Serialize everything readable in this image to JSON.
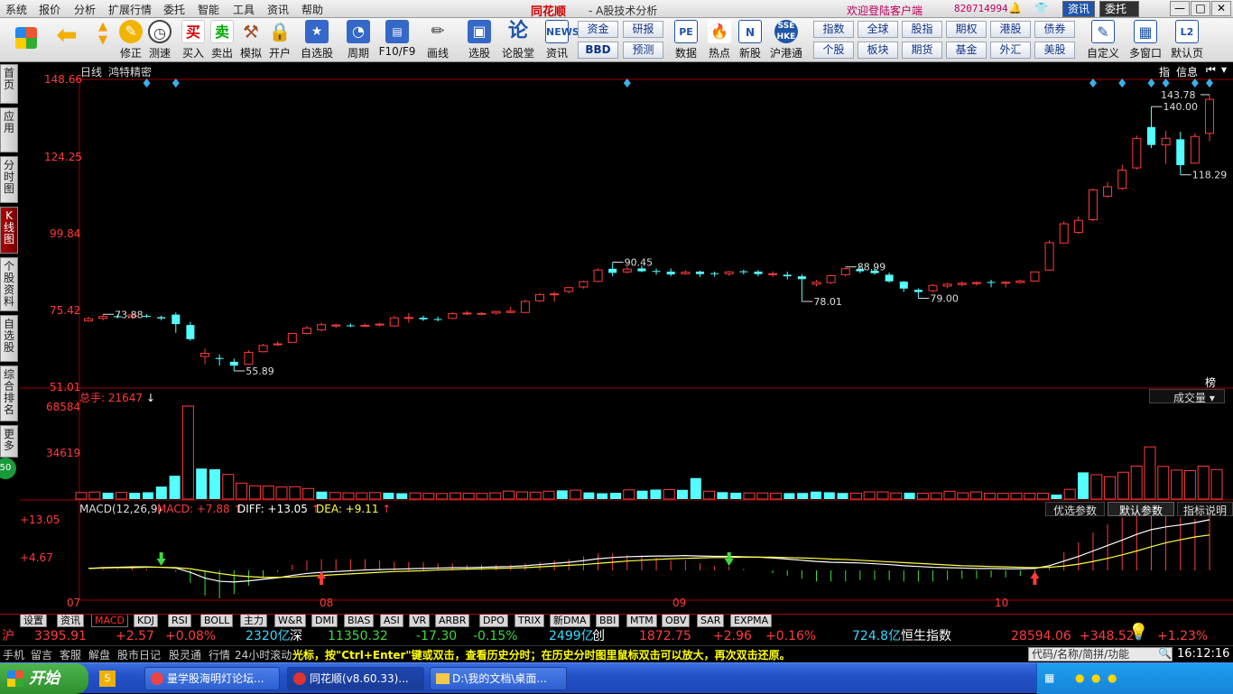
{
  "menubar": {
    "items": [
      "系统",
      "报价",
      "分析",
      "扩展行情",
      "委托",
      "智能",
      "工具",
      "资讯",
      "帮助"
    ],
    "app_name": "同花顺",
    "app_subtitle": "- A股技术分析",
    "welcome": "欢迎登陆客户端",
    "account": "820714994",
    "news_btn": "资讯",
    "trade_btn": "委托",
    "win_min": "—",
    "win_max": "□",
    "win_close": "✕"
  },
  "toolbar": {
    "buttons": [
      "",
      "",
      "修正",
      "测速",
      "买入",
      "卖出",
      "模拟",
      "开户",
      "自选股",
      "周期",
      "F10/F9",
      "画线",
      "选股",
      "论股堂",
      "资讯",
      "数据",
      "热点",
      "新股",
      "沪港通",
      "自定义",
      "多窗口",
      "默认页"
    ],
    "small_left": [
      "资金",
      "BBD",
      "研报",
      "预测"
    ],
    "small_right": [
      "指数",
      "全球",
      "股指",
      "期权",
      "港股",
      "债券",
      "个股",
      "板块",
      "期货",
      "基金",
      "外汇",
      "美股"
    ]
  },
  "leftnav": [
    "首页",
    "应用",
    "分时图",
    "K线图",
    "个股资料",
    "自选股",
    "综合排名",
    "更多"
  ],
  "chart_header": {
    "period": "日线",
    "stock_name": "鸿特精密",
    "corner_btn": "指",
    "info_btn": "信息",
    "bang": "榜"
  },
  "price_axis": [
    "148.66",
    "124.25",
    "99.84",
    "75.42",
    "51.01"
  ],
  "annotations": [
    "73.88",
    "55.89",
    "90.45",
    "78.01",
    "88.99",
    "79.00",
    "118.29",
    "140.00",
    "143.78"
  ],
  "volume_panel": {
    "label": "总手: 21647",
    "axis": [
      "68584",
      "34619"
    ],
    "type_select": "成交量"
  },
  "macd_panel": {
    "title": "MACD(12,26,9)",
    "macd": "MACD: +7.88",
    "diff": "DIFF: +13.05",
    "dea": "DEA: +9.11",
    "axis": [
      "+13.05",
      "+4.67"
    ],
    "btn_opt": "优选参数",
    "btn_default": "默认参数",
    "btn_desc": "指标说明"
  },
  "month_labels": [
    "07",
    "08",
    "09",
    "10"
  ],
  "bottom_tabs": [
    "设置",
    "资讯",
    "MACD",
    "KDJ",
    "RSI",
    "BOLL",
    "主力",
    "W&R",
    "DMI",
    "BIAS",
    "ASI",
    "VR",
    "ARBR",
    "DPO",
    "TRIX",
    "新DMA",
    "BBI",
    "MTM",
    "OBV",
    "SAR",
    "EXPMA"
  ],
  "quote_bar": {
    "sh_label": "沪",
    "sh_index": "3395.91",
    "sh_change": "+2.57",
    "sh_pct": "+0.08%",
    "sh_amount": "2320亿",
    "sz_label": "深",
    "sz_index": "11350.32",
    "sz_change": "-17.30",
    "sz_pct": "-0.15%",
    "sz_amount": "2499亿",
    "cy_label": "创",
    "cy_index": "1872.75",
    "cy_change": "+2.96",
    "cy_pct": "+0.16%",
    "cy_amount": "724.8亿",
    "hs_label": "恒生指数",
    "hs_index": "28594.06",
    "hs_change": "+348.52",
    "hs_pct": "+1.23%"
  },
  "info_bar": {
    "items": [
      "手机",
      "留言",
      "客服",
      "解盘",
      "股市日记",
      "股灵通",
      "行情",
      "24小时滚动"
    ],
    "tips": "光标，按\"Ctrl+Enter\"键或双击，查看历史分时；在历史分时图里鼠标双击可以放大，再次双击还原。",
    "search_placeholder": "代码/名称/简拼/功能",
    "clock": "16:12:16"
  },
  "taskbar": {
    "start": "开始",
    "tasks": [
      "量学股海明灯论坛...",
      "同花顺(v8.60.33)...",
      "D:\\我的文档\\桌面..."
    ]
  },
  "chart_data": {
    "type": "candlestick",
    "ylim": [
      51.01,
      148.66
    ],
    "ohlc": [
      [
        71.8,
        73.1,
        71.5,
        72.5
      ],
      [
        72.6,
        73.9,
        72.0,
        73.2
      ],
      [
        73.3,
        73.8,
        72.7,
        73.0
      ],
      [
        73.1,
        73.9,
        72.4,
        73.7
      ],
      [
        73.4,
        74.0,
        72.8,
        73.1
      ],
      [
        73.0,
        73.5,
        72.0,
        72.6
      ],
      [
        73.8,
        74.5,
        68.0,
        70.8
      ],
      [
        70.5,
        71.5,
        65.5,
        66.0
      ],
      [
        60.5,
        63.0,
        58.0,
        61.5
      ],
      [
        60.0,
        61.2,
        57.6,
        59.7
      ],
      [
        58.8,
        59.8,
        55.9,
        57.6
      ],
      [
        58.0,
        62.5,
        57.8,
        61.8
      ],
      [
        62.0,
        64.5,
        61.8,
        64.0
      ],
      [
        64.3,
        65.4,
        63.8,
        64.5
      ],
      [
        65.0,
        68.0,
        64.8,
        67.8
      ],
      [
        67.8,
        70.2,
        67.5,
        69.5
      ],
      [
        69.0,
        71.2,
        68.5,
        70.6
      ],
      [
        70.2,
        71.0,
        69.6,
        70.5
      ],
      [
        70.4,
        71.0,
        69.8,
        70.3
      ],
      [
        70.3,
        71.0,
        69.9,
        70.4
      ],
      [
        70.5,
        71.2,
        70.0,
        70.8
      ],
      [
        70.2,
        73.3,
        70.0,
        72.8
      ],
      [
        72.6,
        74.3,
        71.2,
        72.9
      ],
      [
        72.8,
        73.5,
        71.8,
        72.3
      ],
      [
        72.4,
        73.2,
        71.7,
        72.2
      ],
      [
        72.6,
        74.5,
        72.4,
        74.1
      ],
      [
        74.2,
        75.0,
        73.6,
        74.3
      ],
      [
        74.0,
        74.6,
        73.6,
        74.2
      ],
      [
        74.3,
        75.0,
        73.8,
        74.8
      ],
      [
        74.5,
        76.3,
        74.3,
        74.9
      ],
      [
        74.5,
        78.5,
        74.3,
        78.0
      ],
      [
        78.2,
        80.6,
        77.8,
        80.2
      ],
      [
        80.2,
        81.2,
        77.9,
        80.4
      ],
      [
        81.2,
        82.6,
        80.6,
        82.4
      ],
      [
        82.6,
        84.6,
        82.1,
        84.3
      ],
      [
        84.4,
        88.5,
        84.2,
        88.0
      ],
      [
        88.4,
        90.5,
        86.0,
        87.1
      ],
      [
        87.4,
        89.0,
        86.9,
        88.3
      ],
      [
        88.5,
        89.4,
        87.3,
        87.6
      ],
      [
        87.7,
        88.5,
        86.5,
        87.5
      ],
      [
        87.5,
        88.5,
        86.0,
        86.6
      ],
      [
        86.8,
        87.9,
        86.5,
        87.3
      ],
      [
        87.5,
        87.8,
        85.8,
        86.7
      ],
      [
        87.0,
        87.5,
        85.9,
        86.9
      ],
      [
        86.8,
        87.7,
        86.1,
        87.4
      ],
      [
        87.6,
        88.1,
        86.6,
        87.3
      ],
      [
        87.5,
        88.0,
        86.0,
        86.7
      ],
      [
        86.8,
        87.6,
        85.8,
        86.8
      ],
      [
        86.5,
        87.5,
        85.0,
        86.0
      ],
      [
        86.0,
        86.7,
        78.0,
        85.1
      ],
      [
        83.5,
        84.8,
        82.8,
        84.1
      ],
      [
        84.0,
        86.5,
        83.6,
        86.2
      ],
      [
        86.5,
        89.0,
        86.0,
        88.4
      ],
      [
        88.3,
        89.1,
        87.0,
        87.6
      ],
      [
        87.8,
        88.7,
        86.5,
        87.0
      ],
      [
        86.5,
        87.2,
        84.0,
        84.4
      ],
      [
        84.3,
        84.5,
        81.0,
        82.1
      ],
      [
        81.7,
        82.2,
        79.0,
        81.0
      ],
      [
        81.4,
        83.5,
        81.0,
        83.1
      ],
      [
        82.9,
        83.9,
        82.2,
        83.5
      ],
      [
        83.4,
        84.4,
        82.8,
        83.8
      ],
      [
        83.7,
        84.4,
        83.0,
        84.0
      ],
      [
        84.2,
        84.9,
        82.5,
        84.0
      ],
      [
        83.8,
        84.5,
        82.4,
        84.1
      ],
      [
        84.0,
        85.0,
        83.7,
        84.5
      ],
      [
        84.5,
        87.5,
        84.3,
        87.4
      ],
      [
        88.0,
        97.5,
        87.8,
        96.7
      ],
      [
        96.6,
        103.5,
        96.5,
        102.7
      ],
      [
        100.0,
        105.0,
        99.5,
        103.8
      ],
      [
        104.0,
        114.0,
        103.5,
        113.5
      ],
      [
        111.5,
        116.0,
        111.0,
        114.5
      ],
      [
        114.0,
        121.5,
        113.5,
        119.8
      ],
      [
        120.5,
        130.8,
        120.0,
        129.9
      ],
      [
        133.5,
        140.0,
        126.8,
        127.8
      ],
      [
        127.8,
        132.3,
        121.8,
        129.9
      ],
      [
        129.6,
        132.0,
        118.3,
        121.4
      ],
      [
        122.0,
        131.5,
        121.8,
        130.5
      ],
      [
        131.5,
        143.8,
        129.0,
        142.3
      ]
    ],
    "volume": [
      4800,
      5200,
      4700,
      4900,
      4600,
      5000,
      9200,
      17200,
      68584,
      22500,
      22000,
      18200,
      11800,
      9800,
      9600,
      8900,
      9100,
      7800,
      5500,
      4800,
      4600,
      4600,
      4800,
      4700,
      4300,
      4500,
      4200,
      4100,
      4500,
      4300,
      4200,
      4600,
      5900,
      5300,
      5100,
      5800,
      6400,
      6600,
      4900,
      4300,
      4600,
      6800,
      6200,
      7000,
      7000,
      6800,
      15500,
      5800,
      5100,
      4700,
      4500,
      4500,
      4300,
      4400,
      4500,
      5500,
      5000,
      4500,
      4400,
      5300,
      5300,
      4500,
      4700,
      4300,
      4500,
      5800,
      4600,
      5300,
      4300,
      4200,
      4400,
      4300,
      4300,
      3300,
      7200,
      19700,
      18000,
      16500,
      19800,
      24300,
      38500,
      24100,
      21400,
      21000,
      24300,
      21800
    ],
    "diff": [
      0.5,
      0.7,
      0.8,
      0.9,
      0.9,
      0.8,
      0.6,
      -0.5,
      -2.0,
      -2.8,
      -3.0,
      -2.7,
      -2.3,
      -1.9,
      -1.3,
      -0.8,
      -0.5,
      -0.3,
      -0.1,
      0.1,
      0.2,
      0.3,
      0.4,
      0.5,
      0.6,
      0.7,
      0.7,
      0.8,
      0.9,
      1.0,
      1.2,
      1.5,
      1.8,
      2.1,
      2.5,
      3.0,
      3.3,
      3.5,
      3.6,
      3.7,
      3.7,
      3.8,
      3.7,
      3.6,
      3.6,
      3.5,
      3.4,
      3.2,
      2.9,
      2.6,
      2.3,
      2.1,
      2.0,
      1.9,
      1.7,
      1.5,
      1.2,
      1.0,
      0.8,
      0.7,
      0.6,
      0.5,
      0.5,
      0.4,
      0.4,
      0.5,
      1.2,
      2.4,
      3.6,
      5.0,
      6.4,
      7.8,
      9.3,
      10.5,
      11.2,
      11.7,
      12.3,
      13.05
    ],
    "dea": [
      0.5,
      0.6,
      0.7,
      0.7,
      0.8,
      0.8,
      0.7,
      0.4,
      -0.2,
      -0.8,
      -1.3,
      -1.6,
      -1.8,
      -1.8,
      -1.7,
      -1.5,
      -1.3,
      -1.1,
      -0.9,
      -0.7,
      -0.5,
      -0.3,
      -0.2,
      -0.1,
      0.1,
      0.2,
      0.3,
      0.4,
      0.5,
      0.6,
      0.7,
      0.9,
      1.1,
      1.3,
      1.5,
      1.8,
      2.1,
      2.4,
      2.6,
      2.8,
      3.0,
      3.1,
      3.2,
      3.3,
      3.3,
      3.4,
      3.4,
      3.4,
      3.3,
      3.2,
      3.1,
      2.9,
      2.8,
      2.6,
      2.4,
      2.2,
      2.0,
      1.8,
      1.6,
      1.4,
      1.2,
      1.1,
      1.0,
      0.9,
      0.8,
      0.7,
      0.8,
      1.1,
      1.6,
      2.3,
      3.1,
      4.0,
      5.0,
      6.1,
      7.1,
      7.9,
      8.6,
      9.11
    ]
  }
}
